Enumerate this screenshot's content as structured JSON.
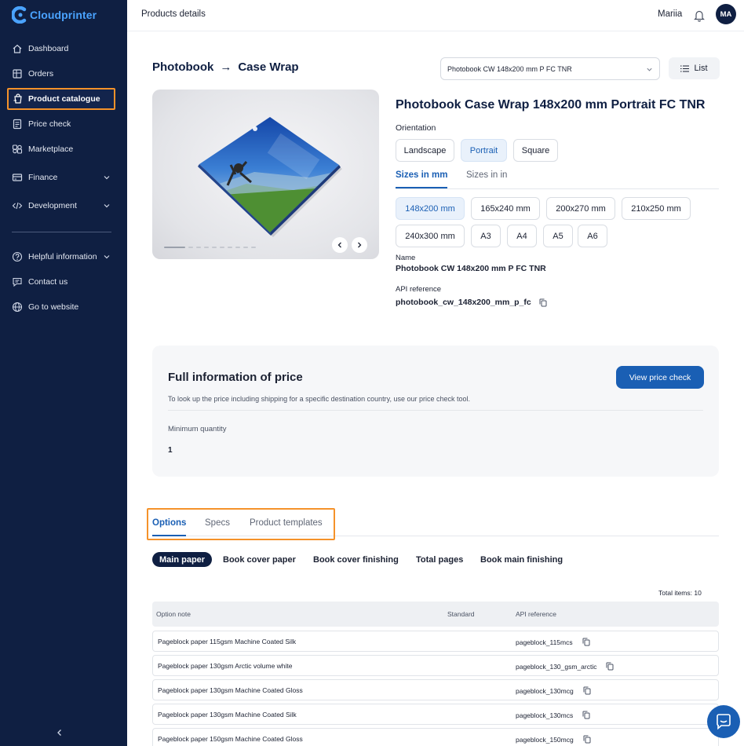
{
  "brand": {
    "name": "Cloudprinter",
    "accent": "#4aa3ff",
    "sidebar_bg": "#0f1f42",
    "primary": "#1a5fb4",
    "highlight": "#f5922a"
  },
  "sidebar": {
    "items": [
      {
        "label": "Dashboard",
        "icon": "home-icon"
      },
      {
        "label": "Orders",
        "icon": "orders-icon"
      },
      {
        "label": "Product catalogue",
        "icon": "catalogue-icon",
        "active": true
      },
      {
        "label": "Price check",
        "icon": "price-check-icon"
      },
      {
        "label": "Marketplace",
        "icon": "marketplace-icon"
      },
      {
        "label": "Finance",
        "icon": "finance-icon",
        "expandable": true
      },
      {
        "label": "Development",
        "icon": "code-icon",
        "expandable": true
      }
    ],
    "footer_items": [
      {
        "label": "Helpful information",
        "icon": "help-icon",
        "expandable": true
      },
      {
        "label": "Contact us",
        "icon": "chat-icon"
      },
      {
        "label": "Go to website",
        "icon": "globe-icon"
      }
    ]
  },
  "topbar": {
    "title": "Products details",
    "user_name": "Mariia",
    "avatar_initials": "MA"
  },
  "breadcrumb": {
    "category": "Photobook",
    "arrow": "→",
    "subcategory": "Case Wrap"
  },
  "product_select": {
    "value": "Photobook CW 148x200 mm P FC TNR"
  },
  "list_button": {
    "label": "List"
  },
  "product": {
    "title": "Photobook Case Wrap 148x200 mm Portrait FC TNR",
    "orientation_label": "Orientation",
    "orientations": [
      "Landscape",
      "Portrait",
      "Square"
    ],
    "selected_orientation": "Portrait",
    "unit_tabs": [
      "Sizes in mm",
      "Sizes in in"
    ],
    "sizes_row1": [
      "148x200 mm",
      "165x240 mm",
      "200x270 mm",
      "210x250 mm"
    ],
    "sizes_row2": [
      "240x300 mm",
      "A3",
      "A4",
      "A5",
      "A6"
    ],
    "selected_size": "148x200 mm",
    "name_label": "Name",
    "name_value": "Photobook CW 148x200 mm P FC TNR",
    "api_label": "API reference",
    "api_value": "photobook_cw_148x200_mm_p_fc"
  },
  "price_info": {
    "title": "Full information of price",
    "description": "To look up the price including shipping for a specific destination country, use our price check tool.",
    "button": "View price check",
    "min_qty_label": "Minimum quantity",
    "min_qty_value": "1"
  },
  "bottom_tabs": [
    "Options",
    "Specs",
    "Product templates"
  ],
  "option_groups": [
    "Main paper",
    "Book cover paper",
    "Book cover finishing",
    "Total pages",
    "Book main finishing"
  ],
  "table": {
    "total_label": "Total items: 10",
    "columns": [
      "Option note",
      "Standard",
      "API reference"
    ],
    "rows": [
      {
        "note": "Pageblock paper 115gsm Machine Coated Silk",
        "api": "pageblock_115mcs"
      },
      {
        "note": "Pageblock paper 130gsm Arctic volume white",
        "api": "pageblock_130_gsm_arctic"
      },
      {
        "note": "Pageblock paper 130gsm Machine Coated Gloss",
        "api": "pageblock_130mcg"
      },
      {
        "note": "Pageblock paper 130gsm Machine Coated Silk",
        "api": "pageblock_130mcs"
      },
      {
        "note": "Pageblock paper 150gsm Machine Coated Gloss",
        "api": "pageblock_150mcg"
      }
    ]
  }
}
